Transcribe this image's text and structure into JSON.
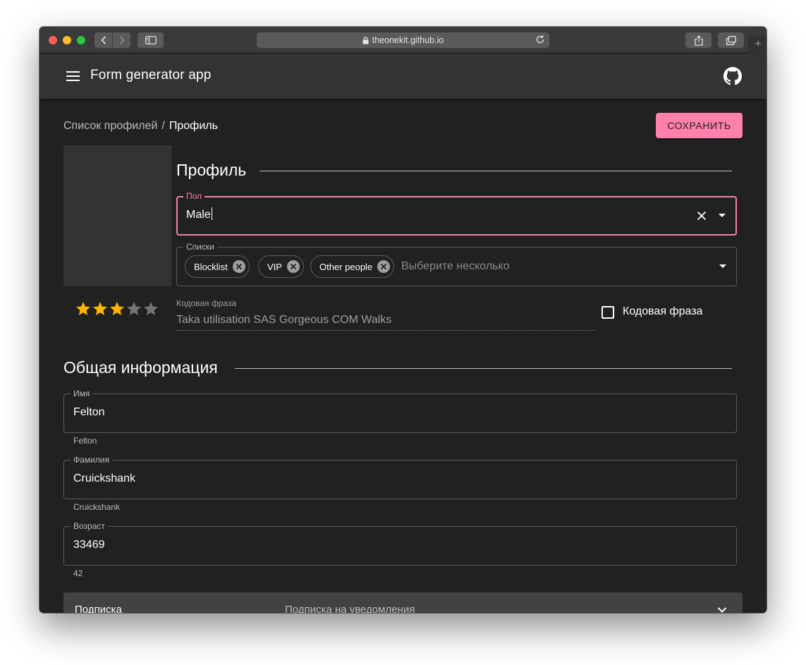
{
  "browser": {
    "url": "theonekit.github.io"
  },
  "appbar": {
    "title": "Form generator app"
  },
  "breadcrumb": {
    "parent": "Список профилей",
    "separator": "/",
    "current": "Профиль"
  },
  "actions": {
    "save_label": "СОХРАНИТЬ"
  },
  "profile": {
    "rating": 3,
    "rating_max": 5,
    "section_title": "Профиль",
    "gender": {
      "label": "Пол",
      "value": "Male"
    },
    "lists": {
      "label": "Списки",
      "chips": [
        "Blocklist",
        "VIP",
        "Other people"
      ],
      "placeholder": "Выберите несколько"
    },
    "codeword": {
      "label": "Кодовая фраза",
      "value": "Taka utilisation SAS Gorgeous COM Walks",
      "checkbox_label": "Кодовая фраза",
      "checked": false
    }
  },
  "general": {
    "section_title": "Общая информация",
    "first_name": {
      "label": "Имя",
      "value": "Felton",
      "helper": "Felton"
    },
    "last_name": {
      "label": "Фамилия",
      "value": "Cruickshank",
      "helper": "Cruickshank"
    },
    "age": {
      "label": "Возраст",
      "value": "33469",
      "helper": "42"
    }
  },
  "subscription": {
    "title": "Подписка",
    "subtitle": "Подписка на уведомления"
  },
  "colors": {
    "accent": "#ff80ab",
    "background": "#212121",
    "appbar": "#333333",
    "star_active": "#ffb400",
    "star_inactive": "#757575"
  }
}
